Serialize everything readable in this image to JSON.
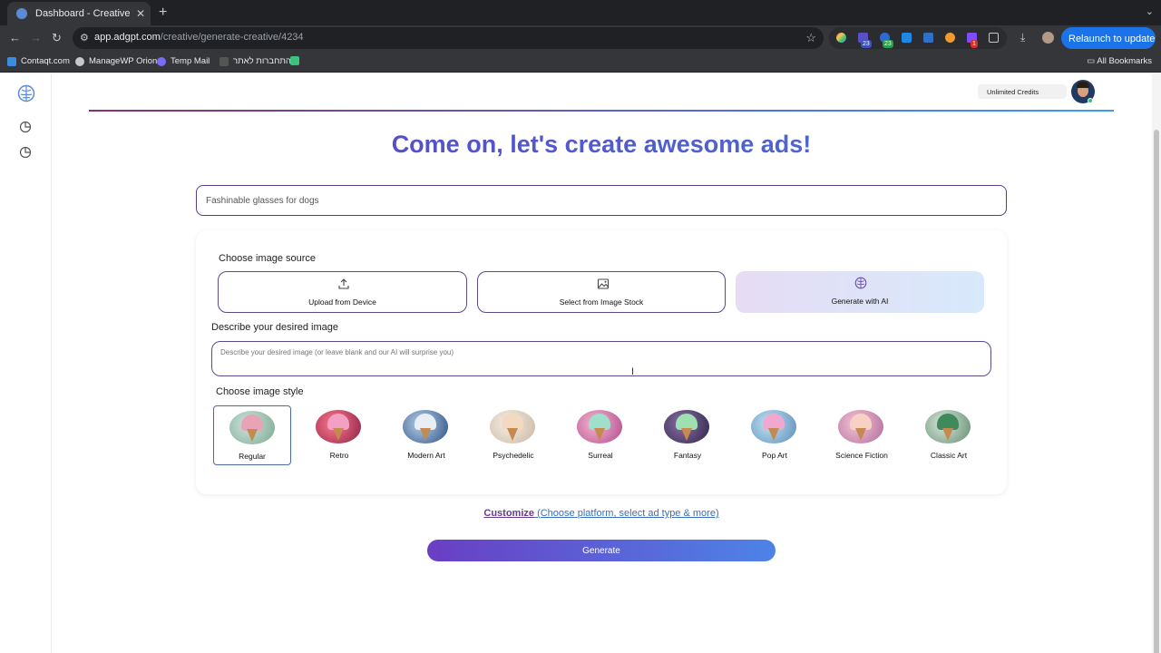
{
  "browser": {
    "tab_title": "Dashboard - Creative | AdGPT",
    "url_domain": "app.adgpt.com",
    "url_path": "/creative/generate-creative/4234",
    "relaunch_label": "Relaunch to update",
    "extension_badges": [
      "23",
      "23",
      "1"
    ],
    "bookmarks": [
      "Contaqt.com",
      "ManageWP Orion",
      "Temp Mail",
      "התחברות לאתר"
    ],
    "all_bookmarks_label": "All Bookmarks"
  },
  "header": {
    "credits_label": "Unlimited Credits"
  },
  "hero": {
    "title": "Come on, let's create awesome ads!"
  },
  "product_input": {
    "value": "Fashinable glasses for dogs"
  },
  "image_source": {
    "label": "Choose image source",
    "options": [
      {
        "label": "Upload from Device",
        "icon": "upload-icon"
      },
      {
        "label": "Select from Image Stock",
        "icon": "image-icon"
      },
      {
        "label": "Generate with AI",
        "icon": "brain-icon",
        "active": true
      }
    ]
  },
  "describe": {
    "label": "Describe your desired image",
    "placeholder": "Describe your desired image (or leave blank and our AI will surprise you)"
  },
  "image_style": {
    "label": "Choose image style",
    "styles": [
      "Regular",
      "Retro",
      "Modern Art",
      "Psychedelic",
      "Surreal",
      "Fantasy",
      "Pop Art",
      "Science Fiction",
      "Classic Art"
    ],
    "selected": "Regular"
  },
  "customize": {
    "strong": "Customize",
    "rest": " (Choose platform, select ad type & more)"
  },
  "generate_label": "Generate",
  "colors": {
    "brand_purple": "#5b3fc4",
    "brand_blue": "#4d83e8",
    "browser_relaunch": "#1a73e8"
  }
}
